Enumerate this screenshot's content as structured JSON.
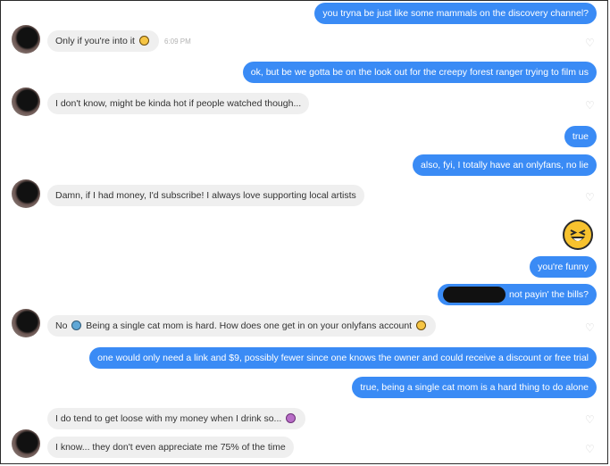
{
  "conversation": {
    "messages": [
      {
        "id": "m1",
        "dir": "out",
        "text": "you tryna be just like some mammals on the discovery channel?"
      },
      {
        "id": "m2",
        "dir": "in",
        "text": "Only if you're into it",
        "emoji": "smirk-emoji",
        "timestamp": "6:09 PM"
      },
      {
        "id": "m3",
        "dir": "out",
        "text": "ok, but be we gotta be on the look out for the creepy forest ranger trying to film us"
      },
      {
        "id": "m4",
        "dir": "in",
        "text": "I don't know, might be kinda hot if people watched though..."
      },
      {
        "id": "m5",
        "dir": "out",
        "text": "true"
      },
      {
        "id": "m6",
        "dir": "out",
        "text": "also, fyi, I totally have an onlyfans, no lie"
      },
      {
        "id": "m7",
        "dir": "in",
        "text": "Damn, if I had money, I'd subscribe! I always love supporting local artists"
      },
      {
        "id": "m8",
        "dir": "out",
        "emoji": "laughing-squint-emoji"
      },
      {
        "id": "m9",
        "dir": "out",
        "text": "you're funny"
      },
      {
        "id": "m10",
        "dir": "out",
        "text": "not payin' the bills?",
        "redacted": true
      },
      {
        "id": "m11",
        "dir": "in",
        "text_before": "No",
        "emoji": "crying-emoji",
        "text": "Being a single cat mom is hard. How does one get in on your onlyfans account",
        "emoji_after": "thinking-emoji"
      },
      {
        "id": "m12",
        "dir": "out",
        "text": "one would only need a link and $9, possibly fewer since one knows the owner and could receive a discount or free trial"
      },
      {
        "id": "m13",
        "dir": "out",
        "text": "true, being a single cat mom is a hard thing to do alone"
      },
      {
        "id": "m14",
        "dir": "in",
        "text": "I do tend to get loose with my money when I drink so...",
        "emoji": "woman-gesturing-emoji"
      },
      {
        "id": "m15",
        "dir": "in",
        "text": "I know... they don't even appreciate me 75% of the time"
      }
    ]
  },
  "colors": {
    "outgoing_bubble": "#3a8bf5",
    "incoming_bubble": "#efefef",
    "heart": "#d4d4d4"
  }
}
